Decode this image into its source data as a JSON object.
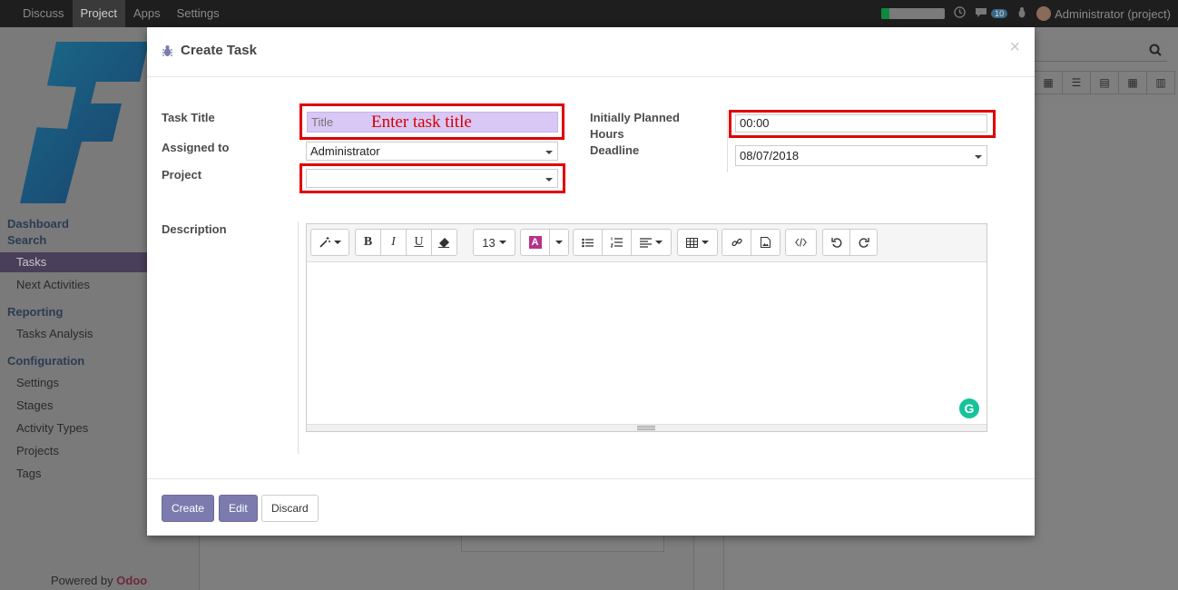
{
  "topbar": {
    "menu": [
      "Discuss",
      "Project",
      "Apps",
      "Settings"
    ],
    "active_menu": "Project",
    "progress_fraction": 0.12,
    "messages_count": "10",
    "user_name": "Administrator (project)"
  },
  "sidebar": {
    "sections": [
      {
        "label": "Dashboard"
      },
      {
        "label": "Search"
      }
    ],
    "items_main": [
      {
        "label": "Tasks",
        "active": true
      },
      {
        "label": "Next Activities"
      }
    ],
    "reporting": {
      "label": "Reporting",
      "items": [
        {
          "label": "Tasks Analysis"
        }
      ]
    },
    "configuration": {
      "label": "Configuration",
      "items": [
        {
          "label": "Settings"
        },
        {
          "label": "Stages"
        },
        {
          "label": "Activity Types"
        },
        {
          "label": "Projects"
        },
        {
          "label": "Tags"
        }
      ]
    },
    "powered_prefix": "Powered by ",
    "powered_brand": "Odoo"
  },
  "modal": {
    "title": "Create Task",
    "close": "×",
    "fields": {
      "task_title": {
        "label": "Task Title",
        "placeholder": "Title",
        "value": ""
      },
      "assigned_to": {
        "label": "Assigned to",
        "value": "Administrator"
      },
      "project": {
        "label": "Project",
        "value": ""
      },
      "planned_hours": {
        "label_line1": "Initially Planned",
        "label_line2": "Hours",
        "value": "00:00"
      },
      "deadline": {
        "label": "Deadline",
        "value": "08/07/2018"
      },
      "description": {
        "label": "Description"
      }
    },
    "annotation": "Enter task title",
    "editor": {
      "font_size": "13"
    },
    "buttons": {
      "create": "Create",
      "edit": "Edit",
      "discard": "Discard"
    }
  },
  "colors": {
    "primary": "#7c7bad",
    "highlight": "#e00000",
    "annotation": "#d40000"
  }
}
